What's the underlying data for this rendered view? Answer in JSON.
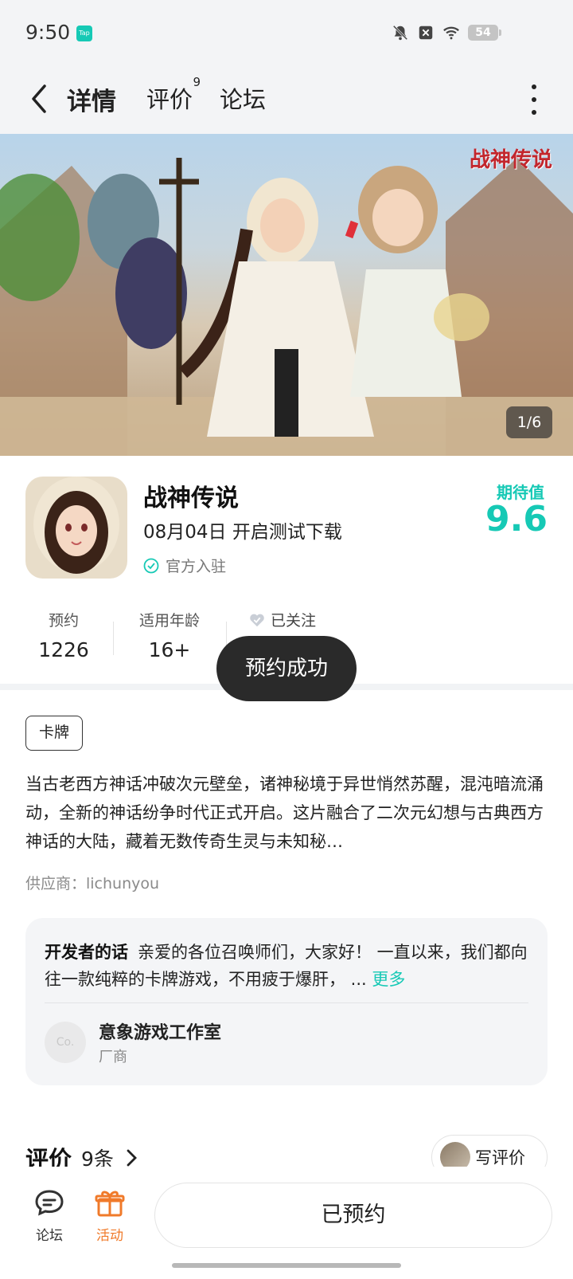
{
  "status": {
    "time": "9:50",
    "tap_badge": "Tap",
    "battery": "54"
  },
  "nav": {
    "tabs": [
      {
        "label": "详情",
        "active": true
      },
      {
        "label": "评价",
        "badge": "9"
      },
      {
        "label": "论坛"
      }
    ]
  },
  "banner": {
    "logo_text": "战神传说",
    "counter": "1/6"
  },
  "app": {
    "name": "战神传说",
    "date_line": "08月04日 开启测试下载",
    "verified": "官方入驻",
    "expect_label": "期待值",
    "expect_value": "9.6"
  },
  "stats": {
    "reserve_label": "预约",
    "reserve_value": "1226",
    "age_label": "适用年龄",
    "age_value": "16+",
    "follow_label": "已关注"
  },
  "toast": "预约成功",
  "tag": "卡牌",
  "description": "当古老西方神话冲破次元壁垒，诸神秘境于异世悄然苏醒，混沌暗流涌动，全新的神话纷争时代正式开启。这片融合了二次元幻想与古典西方神话的大陆，藏着无数传奇生灵与未知秘…",
  "supplier": "供应商：lichunyou",
  "developer": {
    "title": "开发者的话",
    "text": "亲爱的各位召唤师们，大家好！ 一直以来，我们都向往一款纯粹的卡牌游戏，不用疲于爆肝， ...",
    "more": "更多",
    "avatar_text": "Co.",
    "name": "意象游戏工作室",
    "role": "厂商"
  },
  "reviews": {
    "title": "评价",
    "count": "9条",
    "write": "写评价"
  },
  "bottom": {
    "forum": "论坛",
    "activity": "活动",
    "reserved": "已预约"
  },
  "colors": {
    "accent": "#16c9b5",
    "activity": "#f07a2a"
  }
}
